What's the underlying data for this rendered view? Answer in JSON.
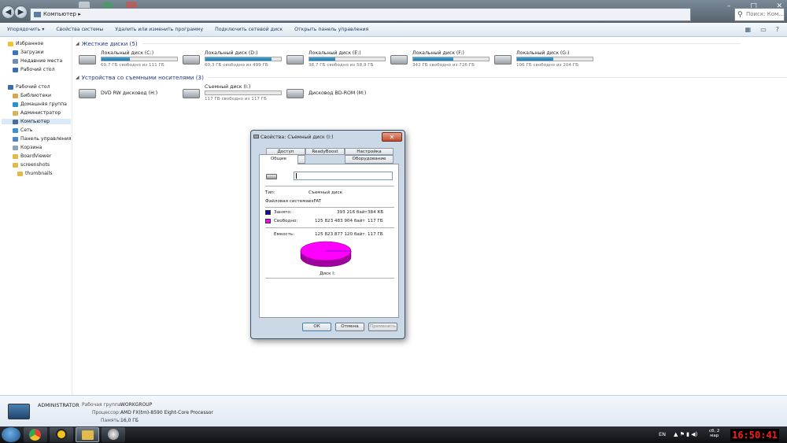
{
  "window": {
    "address_path": "Компьютер",
    "address_sep": "▸",
    "search_placeholder": "Поиск: Ком..."
  },
  "toolbar": {
    "items": [
      "Упорядочить ▾",
      "Свойства системы",
      "Удалить или изменить программу",
      "Подключить сетевой диск",
      "Открыть панель управления"
    ]
  },
  "sidebar": {
    "items": [
      {
        "label": "Избранное",
        "icon": "star-icon",
        "color": "#f2c230"
      },
      {
        "label": "Загрузки",
        "icon": "downloads-icon",
        "color": "#3b74b8"
      },
      {
        "label": "Недавние места",
        "icon": "recent-places-icon",
        "color": "#6f8fb0"
      },
      {
        "label": "Рабочий стол",
        "icon": "desktop-icon",
        "color": "#3a6ea8"
      },
      {
        "label": "Рабочий стол",
        "icon": "desktop-icon",
        "color": "#3a6ea8"
      },
      {
        "label": "Библиотеки",
        "icon": "library-icon",
        "color": "#d9a64a"
      },
      {
        "label": "Домашняя группа",
        "icon": "homegroup-icon",
        "color": "#2e8fd0"
      },
      {
        "label": "Администратор",
        "icon": "user-folder-icon",
        "color": "#d9b45e"
      },
      {
        "label": "Компьютер",
        "icon": "computer-icon",
        "color": "#4a6d96"
      },
      {
        "label": "Сеть",
        "icon": "network-icon",
        "color": "#3c8fd4"
      },
      {
        "label": "Панель управления",
        "icon": "control-panel-icon",
        "color": "#4f86c6"
      },
      {
        "label": "Корзина",
        "icon": "recycle-bin-icon",
        "color": "#8ea3b6"
      },
      {
        "label": "BoardViewer",
        "icon": "folder-icon",
        "color": "#e3b94b"
      },
      {
        "label": "screenshots",
        "icon": "folder-icon",
        "color": "#e3b94b"
      },
      {
        "label": "thumbnails",
        "icon": "folder-icon",
        "color": "#e3b94b"
      }
    ]
  },
  "groups": {
    "hard": "Жесткие диски (5)",
    "removable": "Устройства со съемными носителями (3)"
  },
  "hard_drives": [
    {
      "name": "Локальный диск (C:)",
      "free": "69,7 ГБ свободно из 111 ГБ",
      "used": 0.37
    },
    {
      "name": "Локальный диск (D:)",
      "free": "60,3 ГБ свободно из 499 ГБ",
      "used": 0.88
    },
    {
      "name": "Локальный диск (E:)",
      "free": "38,7 ГБ свободно из 58,9 ГБ",
      "used": 0.34
    },
    {
      "name": "Локальный диск (F:)",
      "free": "342 ГБ свободно из 726 ГБ",
      "used": 0.53
    },
    {
      "name": "Локальный диск (G:)",
      "free": "106 ГБ свободно из 204 ГБ",
      "used": 0.48
    }
  ],
  "removable": [
    {
      "name": "DVD RW дисковод (H:)"
    },
    {
      "name": "Съемный диск (I:)",
      "free": "117 ГБ свободно из 117 ГБ",
      "used": 0.0
    },
    {
      "name": "Дисковод BD-ROM (M:)"
    }
  ],
  "dialog": {
    "title": "Свойства: Съемный диск (I:)",
    "tabs_top": [
      "Доступ",
      "ReadyBoost",
      "Настройка"
    ],
    "tabs_bottom": [
      "Общие",
      "Сервис",
      "Оборудование"
    ],
    "name_value": "",
    "type_label": "Тип:",
    "type_value": "Съемный диск",
    "fs_label": "Файловая система:",
    "fs_value": "exFAT",
    "used_label": "Занято:",
    "used_bytes": "393 216 байт",
    "used_size": "384 КБ",
    "free_label": "Свободно:",
    "free_bytes": "125 823 483 904 байт",
    "free_size": "117 ГБ",
    "cap_label": "Емкость:",
    "cap_bytes": "125 823 877 120 байт",
    "cap_size": "117 ГБ",
    "disk_label": "Диск I:",
    "used_color": "#0a0a9c",
    "free_color": "#ff00ff",
    "used_fraction": 3e-06,
    "buttons": [
      "ОК",
      "Отмена",
      "Применить"
    ]
  },
  "details": {
    "user": "ADMINISTRATOR",
    "wg_label": "Рабочая группа:",
    "wg_value": "WORKGROUP",
    "cpu_label": "Процессор:",
    "cpu_value": "AMD FX(tm)-8590 Eight-Core Processor",
    "mem_label": "Память:",
    "mem_value": "16,0 ГБ"
  },
  "taskbar": {
    "lang": "EN",
    "date_top": "сб, 2",
    "date_bottom": "мар",
    "clock": "16:50:41"
  }
}
